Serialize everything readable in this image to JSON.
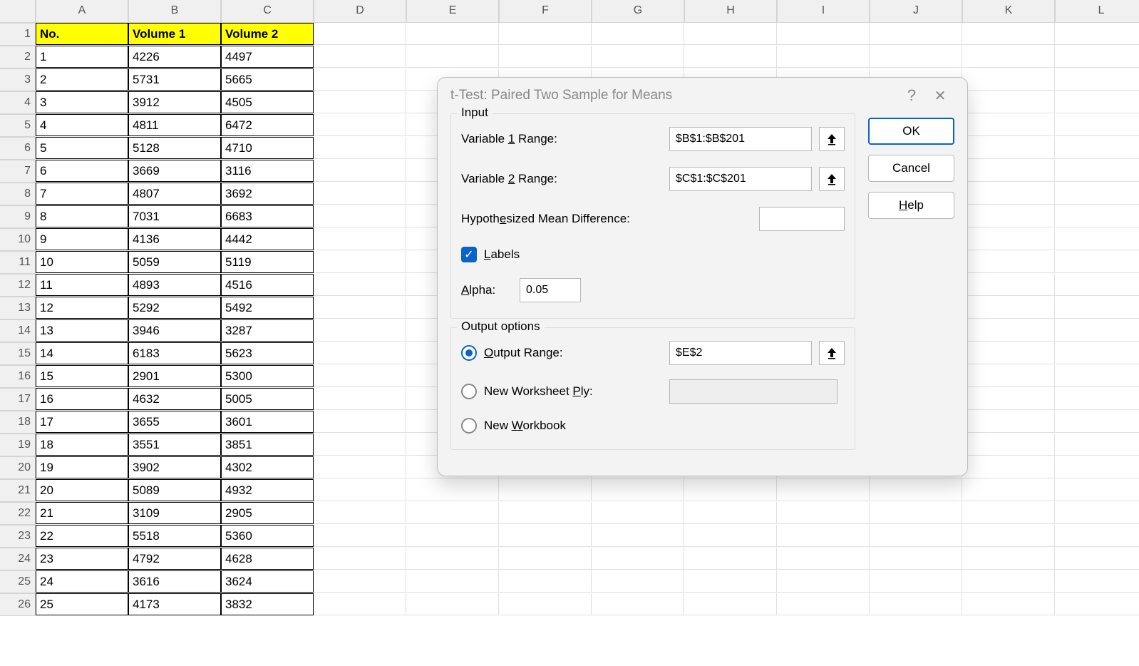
{
  "columns": [
    "A",
    "B",
    "C",
    "D",
    "E",
    "F",
    "G",
    "H",
    "I",
    "J",
    "K",
    "L"
  ],
  "table": {
    "headers": {
      "no": "No.",
      "v1": "Volume 1",
      "v2": "Volume 2"
    },
    "rows": [
      {
        "no": "1",
        "v1": "4226",
        "v2": "4497"
      },
      {
        "no": "2",
        "v1": "5731",
        "v2": "5665"
      },
      {
        "no": "3",
        "v1": "3912",
        "v2": "4505"
      },
      {
        "no": "4",
        "v1": "4811",
        "v2": "6472"
      },
      {
        "no": "5",
        "v1": "5128",
        "v2": "4710"
      },
      {
        "no": "6",
        "v1": "3669",
        "v2": "3116"
      },
      {
        "no": "7",
        "v1": "4807",
        "v2": "3692"
      },
      {
        "no": "8",
        "v1": "7031",
        "v2": "6683"
      },
      {
        "no": "9",
        "v1": "4136",
        "v2": "4442"
      },
      {
        "no": "10",
        "v1": "5059",
        "v2": "5119"
      },
      {
        "no": "11",
        "v1": "4893",
        "v2": "4516"
      },
      {
        "no": "12",
        "v1": "5292",
        "v2": "5492"
      },
      {
        "no": "13",
        "v1": "3946",
        "v2": "3287"
      },
      {
        "no": "14",
        "v1": "6183",
        "v2": "5623"
      },
      {
        "no": "15",
        "v1": "2901",
        "v2": "5300"
      },
      {
        "no": "16",
        "v1": "4632",
        "v2": "5005"
      },
      {
        "no": "17",
        "v1": "3655",
        "v2": "3601"
      },
      {
        "no": "18",
        "v1": "3551",
        "v2": "3851"
      },
      {
        "no": "19",
        "v1": "3902",
        "v2": "4302"
      },
      {
        "no": "20",
        "v1": "5089",
        "v2": "4932"
      },
      {
        "no": "21",
        "v1": "3109",
        "v2": "2905"
      },
      {
        "no": "22",
        "v1": "5518",
        "v2": "5360"
      },
      {
        "no": "23",
        "v1": "4792",
        "v2": "4628"
      },
      {
        "no": "24",
        "v1": "3616",
        "v2": "3624"
      },
      {
        "no": "25",
        "v1": "4173",
        "v2": "3832"
      }
    ]
  },
  "dialog": {
    "title": "t-Test: Paired Two Sample for Means",
    "groups": {
      "input": "Input",
      "output": "Output options"
    },
    "labels": {
      "var1": "Variable 1 Range:",
      "var2": "Variable 2 Range:",
      "hypo": "Hypothesized Mean Difference:",
      "labels": "Labels",
      "alpha": "Alpha:",
      "output_range": "Output Range:",
      "new_ws": "New Worksheet Ply:",
      "new_wb": "New Workbook"
    },
    "values": {
      "var1": "$B$1:$B$201",
      "var2": "$C$1:$C$201",
      "hypo": "",
      "alpha": "0.05",
      "output_range": "$E$2",
      "new_ws": ""
    },
    "buttons": {
      "ok": "OK",
      "cancel": "Cancel",
      "help": "Help"
    }
  }
}
